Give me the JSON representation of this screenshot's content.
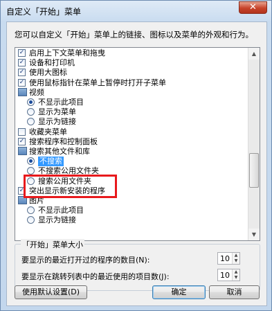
{
  "window": {
    "title": "自定义「开始」菜单",
    "close_symbol": "✕"
  },
  "description": "您可以自定义「开始」菜单上的链接、图标以及菜单的外观和行为。",
  "list_items": [
    {
      "kind": "checkbox",
      "checked": true,
      "label": "启用上下文菜单和拖曳",
      "indent": 0
    },
    {
      "kind": "checkbox",
      "checked": true,
      "label": "设备和打印机",
      "indent": 0
    },
    {
      "kind": "checkbox",
      "checked": true,
      "label": "使用大图标",
      "indent": 0
    },
    {
      "kind": "checkbox",
      "checked": true,
      "label": "使用鼠标指针在菜单上暂停时打开子菜单",
      "indent": 0
    },
    {
      "kind": "folder",
      "label": "视频",
      "indent": 0
    },
    {
      "kind": "radio",
      "checked": true,
      "label": "不显示此项目",
      "indent": 1
    },
    {
      "kind": "radio",
      "checked": false,
      "label": "显示为菜单",
      "indent": 1
    },
    {
      "kind": "radio",
      "checked": false,
      "label": "显示为链接",
      "indent": 1
    },
    {
      "kind": "checkbox",
      "checked": false,
      "label": "收藏夹菜单",
      "indent": 0
    },
    {
      "kind": "checkbox",
      "checked": true,
      "label": "搜索程序和控制面板",
      "indent": 0
    },
    {
      "kind": "folder",
      "label": "搜索其他文件和库",
      "indent": 0
    },
    {
      "kind": "radio",
      "checked": true,
      "label": "不搜索",
      "indent": 1,
      "selected": true
    },
    {
      "kind": "radio",
      "checked": false,
      "label": "不搜索公用文件夹",
      "indent": 1
    },
    {
      "kind": "radio",
      "checked": false,
      "label": "搜索公用文件夹",
      "indent": 1
    },
    {
      "kind": "checkbox",
      "checked": true,
      "label": "突出显示新安装的程序",
      "indent": 0
    },
    {
      "kind": "folder",
      "label": "图片",
      "indent": 0
    },
    {
      "kind": "radio",
      "checked": false,
      "label": "不显示此项目",
      "indent": 1
    },
    {
      "kind": "radio",
      "checked": false,
      "label": "显示为链接",
      "indent": 1
    }
  ],
  "size_group": {
    "title": "「开始」菜单大小",
    "recent_programs_label": "要显示的最近打开过的程序的数目(N):",
    "recent_programs_value": "10",
    "jumplist_label": "要显示在跳转列表中的最近使用的项目数(J):",
    "jumplist_value": "10"
  },
  "buttons": {
    "defaults": "使用默认设置(D)",
    "ok": "确定",
    "cancel": "取消"
  },
  "icons": {
    "checkbox_mark": "✓",
    "spin_up": "▲",
    "spin_down": "▼",
    "scroll_up": "▲",
    "scroll_down": "▼"
  }
}
